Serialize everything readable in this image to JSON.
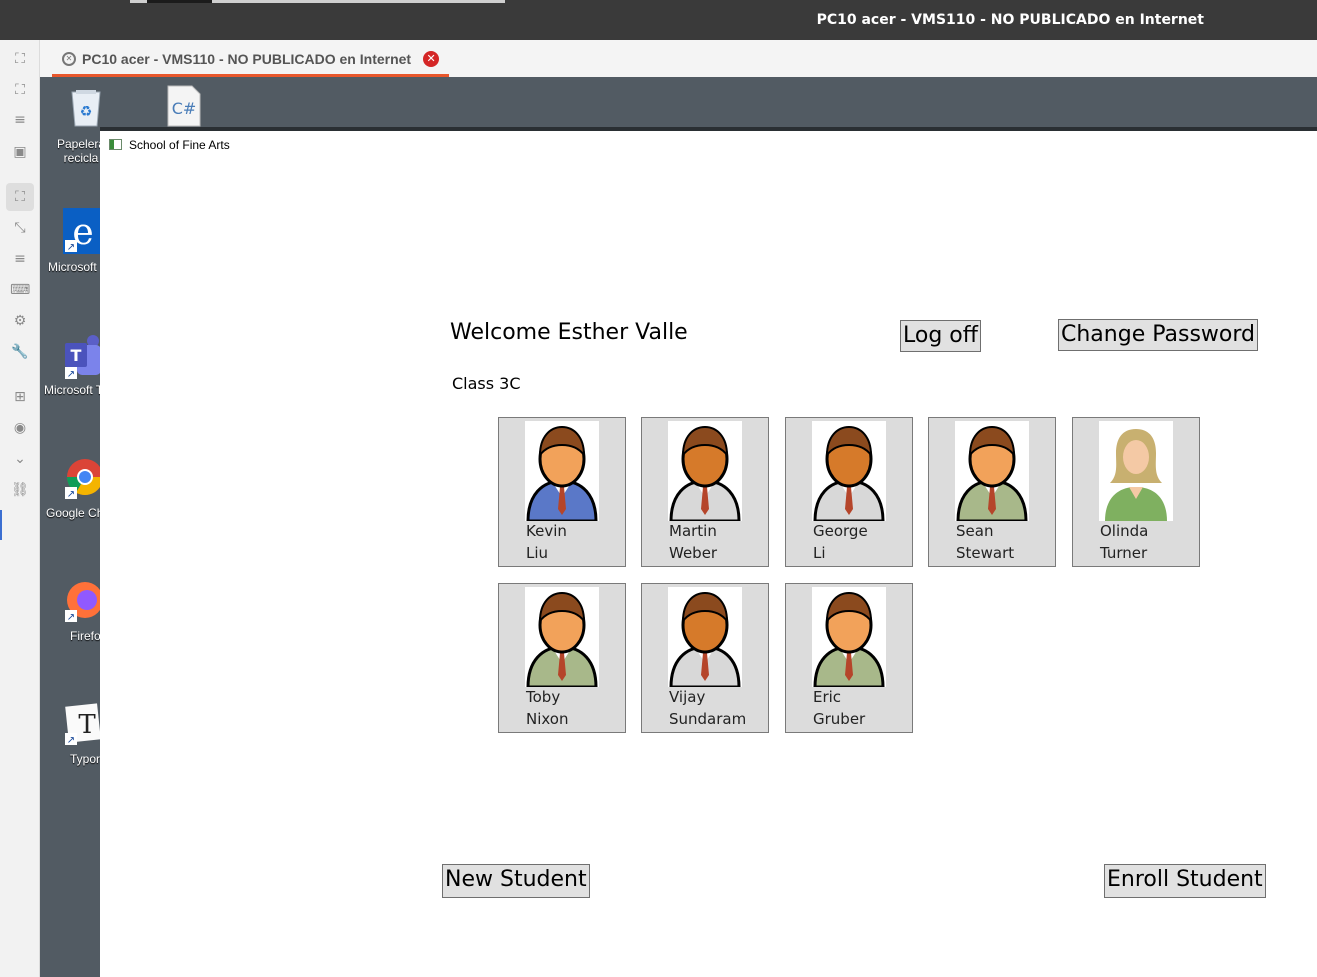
{
  "outer_window": {
    "title": "PC10 acer - VMS110 - NO PUBLICADO en Internet"
  },
  "tab": {
    "title": "PC10 acer - VMS110 - NO PUBLICADO en Internet",
    "close_icon": "close-icon",
    "accent_color": "#e8572c"
  },
  "left_toolbar": {
    "icons": [
      "fit-screen-icon",
      "fullscreen-icon",
      "menu-icon",
      "window-icon",
      "scale-icon",
      "resize-icon",
      "list-icon",
      "keyboard-icon",
      "settings-icon",
      "wrench-icon",
      "add-window-icon",
      "camera-icon",
      "chevron-down-icon",
      "link-icon"
    ]
  },
  "desktop": {
    "background_color": "#525b63",
    "icons": [
      {
        "label": "Papelera\nrecicla",
        "icon": "recycle-bin-icon"
      },
      {
        "label": "",
        "icon": "csharp-file-icon"
      },
      {
        "label": "Microsoft",
        "icon": "edge-icon"
      },
      {
        "label": "Microsoft T",
        "icon": "teams-icon"
      },
      {
        "label": "Google Ch",
        "icon": "chrome-icon"
      },
      {
        "label": "Firefo",
        "icon": "firefox-icon"
      },
      {
        "label": "Typor",
        "icon": "typora-icon"
      }
    ]
  },
  "app": {
    "title": "School of Fine Arts",
    "welcome": "Welcome Esther Valle",
    "class_label": "Class 3C",
    "buttons": {
      "log_off": "Log off",
      "change_password": "Change Password",
      "new_student": "New Student",
      "enroll_student": "Enroll Student"
    },
    "students": [
      {
        "first": "Kevin",
        "last": "Liu",
        "shirt": "#5a78c8",
        "skin": "#f2a25a",
        "hair": "#8b4a1e"
      },
      {
        "first": "Martin",
        "last": "Weber",
        "shirt": "#d8d8d8",
        "skin": "#d67a2a",
        "hair": "#8b4a1e"
      },
      {
        "first": "George",
        "last": "Li",
        "shirt": "#d8d8d8",
        "skin": "#d67a2a",
        "hair": "#8b4a1e"
      },
      {
        "first": "Sean",
        "last": "Stewart",
        "shirt": "#a8b88a",
        "skin": "#f2a25a",
        "hair": "#8b4a1e"
      },
      {
        "first": "Olinda",
        "last": "Turner",
        "shirt": "#7fb060",
        "skin": "#f4c9a5",
        "hair": "#c8b070"
      },
      {
        "first": "Toby",
        "last": "Nixon",
        "shirt": "#a8b88a",
        "skin": "#f2a25a",
        "hair": "#8b4a1e"
      },
      {
        "first": "Vijay",
        "last": "Sundaram",
        "shirt": "#d8d8d8",
        "skin": "#d67a2a",
        "hair": "#8b4a1e"
      },
      {
        "first": "Eric",
        "last": "Gruber",
        "shirt": "#a8b88a",
        "skin": "#f2a25a",
        "hair": "#8b4a1e"
      }
    ]
  }
}
